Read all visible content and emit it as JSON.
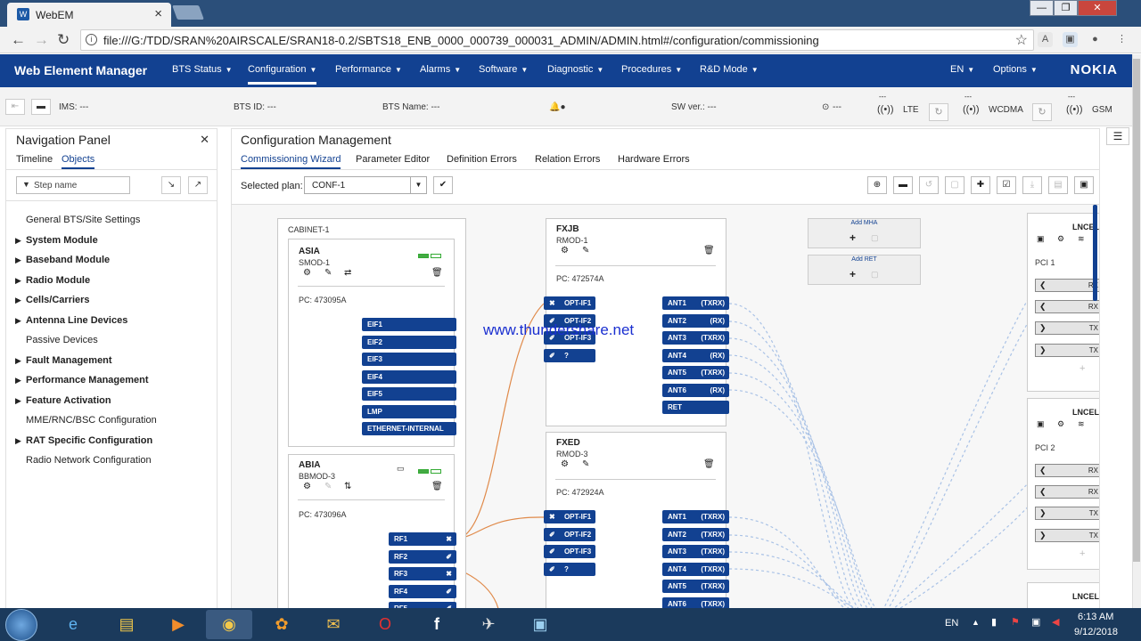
{
  "browser": {
    "tab_title": "WebEM",
    "url": "file:///G:/TDD/SRAN%20AIRSCALE/SRAN18-0.2/SBTS18_ENB_0000_000739_000031_ADMIN/ADMIN.html#/configuration/commissioning",
    "window_buttons": {
      "minimize": "—",
      "maximize": "❐",
      "close": "✕"
    }
  },
  "app": {
    "brand": "Web Element Manager",
    "menus": [
      "BTS Status",
      "Configuration",
      "Performance",
      "Alarms",
      "Software",
      "Diagnostic",
      "Procedures",
      "R&D Mode"
    ],
    "lang": "EN",
    "options": "Options",
    "logo": "NOKIA"
  },
  "infobar": {
    "ims": "IMS: ---",
    "bts_id": "BTS ID:  ---",
    "bts_name": "BTS Name:  ---",
    "sw_ver": "SW ver.:  ---",
    "clock": "---",
    "radios": [
      {
        "top": "---",
        "name": "LTE"
      },
      {
        "top": "---",
        "name": "WCDMA"
      },
      {
        "top": "---",
        "name": "GSM"
      }
    ]
  },
  "nav": {
    "title": "Navigation Panel",
    "tabs": [
      "Timeline",
      "Objects"
    ],
    "step_placeholder": "Step name",
    "items": [
      {
        "label": "General BTS/Site Settings",
        "expand": false,
        "bold": false
      },
      {
        "label": "System Module",
        "expand": true,
        "bold": true
      },
      {
        "label": "Baseband Module",
        "expand": true,
        "bold": true
      },
      {
        "label": "Radio Module",
        "expand": true,
        "bold": true
      },
      {
        "label": "Cells/Carriers",
        "expand": true,
        "bold": true
      },
      {
        "label": "Antenna Line Devices",
        "expand": true,
        "bold": true
      },
      {
        "label": "Passive Devices",
        "expand": false,
        "bold": false
      },
      {
        "label": "Fault Management",
        "expand": true,
        "bold": true
      },
      {
        "label": "Performance Management",
        "expand": true,
        "bold": true
      },
      {
        "label": "Feature Activation",
        "expand": true,
        "bold": true
      },
      {
        "label": "MME/RNC/BSC Configuration",
        "expand": false,
        "bold": false
      },
      {
        "label": "RAT Specific Configuration",
        "expand": true,
        "bold": true
      },
      {
        "label": "Radio Network Configuration",
        "expand": false,
        "bold": false
      }
    ]
  },
  "config": {
    "title": "Configuration Management",
    "tabs": [
      "Commissioning Wizard",
      "Parameter Editor",
      "Definition Errors",
      "Relation Errors",
      "Hardware Errors"
    ],
    "plan_label": "Selected plan:",
    "plan_value": "CONF-1",
    "cabinet": "CABINET-1",
    "smod": {
      "name": "ASIA",
      "type": "SMOD-1",
      "pc": "PC:   473095A",
      "ports": [
        "EIF1",
        "EIF2",
        "EIF3",
        "EIF4",
        "EIF5",
        "LMP",
        "ETHERNET-INTERNAL"
      ]
    },
    "bbmod": {
      "name": "ABIA",
      "type": "BBMOD-3",
      "pc": "PC:   473096A",
      "ports": [
        "RF1",
        "RF2",
        "RF3",
        "RF4",
        "RF5"
      ]
    },
    "rmod1": {
      "name": "FXJB",
      "type": "RMOD-1",
      "pc": "PC:   472574A",
      "opt": [
        "OPT-IF1",
        "OPT-IF2",
        "OPT-IF3",
        "?"
      ],
      "ant": [
        {
          "n": "ANT1",
          "t": "(TXRX)"
        },
        {
          "n": "ANT2",
          "t": "(RX)"
        },
        {
          "n": "ANT3",
          "t": "(TXRX)"
        },
        {
          "n": "ANT4",
          "t": "(RX)"
        },
        {
          "n": "ANT5",
          "t": "(TXRX)"
        },
        {
          "n": "ANT6",
          "t": "(RX)"
        },
        {
          "n": "RET",
          "t": ""
        }
      ]
    },
    "rmod3": {
      "name": "FXED",
      "type": "RMOD-3",
      "pc": "PC:   472924A",
      "opt": [
        "OPT-IF1",
        "OPT-IF2",
        "OPT-IF3",
        "?"
      ],
      "ant": [
        {
          "n": "ANT1",
          "t": "(TXRX)"
        },
        {
          "n": "ANT2",
          "t": "(TXRX)"
        },
        {
          "n": "ANT3",
          "t": "(TXRX)"
        },
        {
          "n": "ANT4",
          "t": "(TXRX)"
        },
        {
          "n": "ANT5",
          "t": "(TXRX)"
        },
        {
          "n": "ANT6",
          "t": "(TXRX)"
        }
      ]
    },
    "add_mha": "Add MHA",
    "add_ret": "Add RET",
    "lncel": [
      {
        "name": "LNCEL",
        "pci": "PCI 1",
        "rows": [
          "RX",
          "RX",
          "TX",
          "TX"
        ]
      },
      {
        "name": "LNCEL",
        "pci": "PCI 2",
        "rows": [
          "RX",
          "RX",
          "TX",
          "TX"
        ]
      },
      {
        "name": "LNCEL"
      }
    ]
  },
  "watermark": "www.thundershare.net",
  "taskbar": {
    "lang": "EN",
    "time": "6:13 AM",
    "date": "9/12/2018"
  }
}
